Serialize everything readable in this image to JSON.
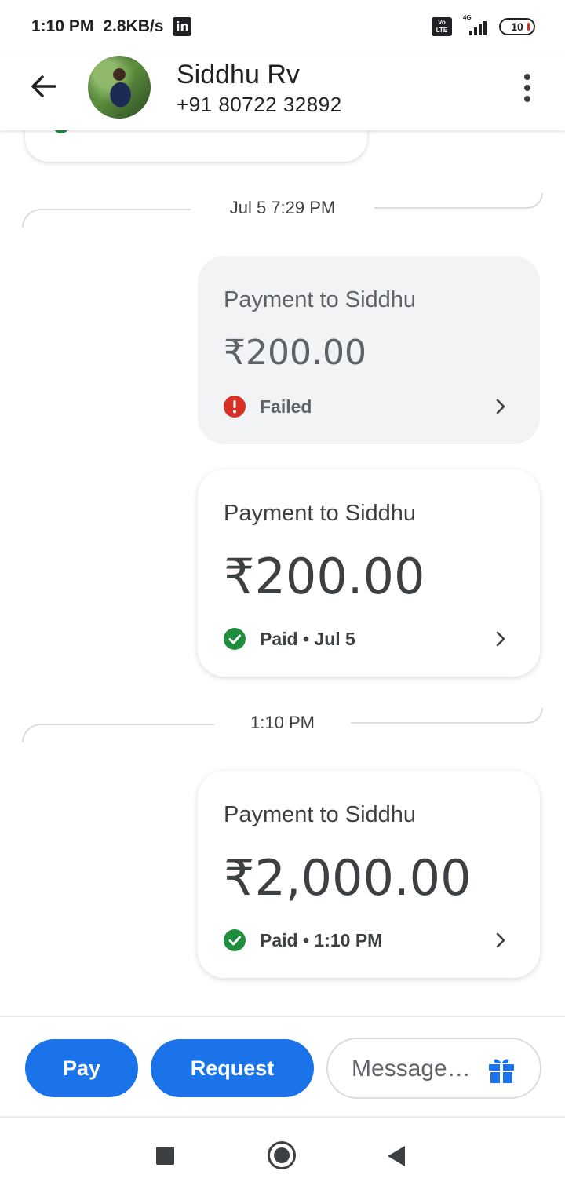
{
  "status_bar": {
    "time": "1:10 PM",
    "network_speed": "2.8KB/s",
    "notification_icon": "linkedin-icon",
    "volte_label": "Vo LTE",
    "signal_label": "4G",
    "battery_level": "10"
  },
  "header": {
    "name": "Siddhu Rv",
    "phone": "+91 80722 32892"
  },
  "conversation": {
    "dividers": [
      {
        "label": "Jul 5 7:29 PM"
      },
      {
        "label": "1:10 PM"
      }
    ],
    "payments": [
      {
        "title": "Payment to Siddhu",
        "amount": "₹200.00",
        "status": "Failed",
        "state": "failed"
      },
      {
        "title": "Payment to Siddhu",
        "amount": "₹200.00",
        "status": "Paid • Jul 5",
        "state": "paid"
      },
      {
        "title": "Payment to Siddhu",
        "amount": "₹2,000.00",
        "status": "Paid • 1:10 PM",
        "state": "paid"
      }
    ]
  },
  "bottom_bar": {
    "pay_label": "Pay",
    "request_label": "Request",
    "message_placeholder": "Message…"
  },
  "colors": {
    "primary": "#1a73e8",
    "success": "#1e8e3e",
    "error": "#d93025",
    "failed_card_bg": "#f1f3f4"
  }
}
